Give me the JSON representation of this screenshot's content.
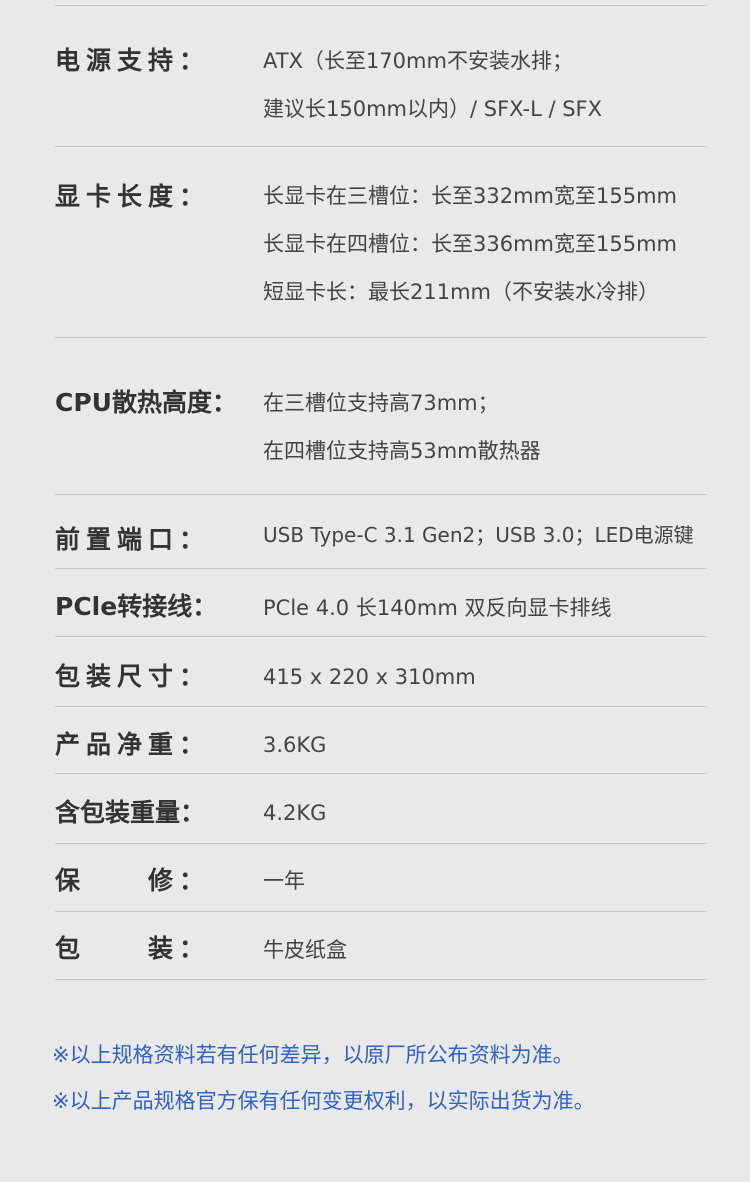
{
  "specs": [
    {
      "label": "电源支持：",
      "values": [
        "ATX（长至170mm不安装水排；",
        "建议长150mm以内）/ SFX-L / SFX"
      ]
    },
    {
      "label": "显卡长度：",
      "values": [
        "长显卡在三槽位：长至332mm宽至155mm",
        "长显卡在四槽位：长至336mm宽至155mm",
        "短显卡长：最长211mm（不安装水冷排）"
      ]
    },
    {
      "label": "CPU散热高度：",
      "values": [
        "在三槽位支持高73mm；",
        "在四槽位支持高53mm散热器"
      ]
    },
    {
      "label": "前置端口：",
      "values": [
        "USB Type-C  3.1 Gen2；USB  3.0；LED电源键"
      ]
    },
    {
      "label": "PCle转接线：",
      "values": [
        "PCle 4.0  长140mm 双反向显卡排线"
      ]
    },
    {
      "label": "包装尺寸：",
      "values": [
        "415 x 220 x 310mm"
      ]
    },
    {
      "label": "产品净重：",
      "values": [
        "3.6KG"
      ]
    },
    {
      "label": "含包装重量：",
      "values": [
        "4.2KG"
      ]
    },
    {
      "label_left": "保",
      "label_right": "修：",
      "values": [
        "一年"
      ]
    },
    {
      "label_left": "包",
      "label_right": "装：",
      "values": [
        "牛皮纸盒"
      ]
    }
  ],
  "notes": [
    "※以上规格资料若有任何差异，以原厂所公布资料为准。",
    "※以上产品规格官方保有任何变更权利，以实际出货为准。"
  ]
}
